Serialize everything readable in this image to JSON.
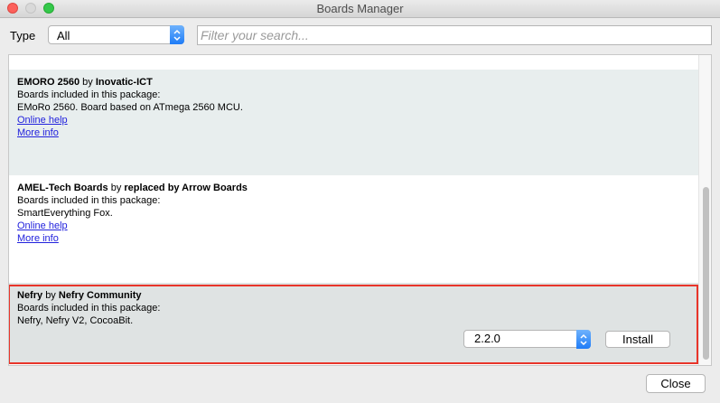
{
  "window": {
    "title": "Boards Manager"
  },
  "toolbar": {
    "type_label": "Type",
    "type_value": "All",
    "search_placeholder": "Filter your search..."
  },
  "boards": [
    {
      "name": "EMORO 2560",
      "by": "by",
      "author": "Inovatic-ICT",
      "included_label": "Boards included in this package:",
      "boards_list": "EMoRo 2560. Board based on ATmega 2560 MCU.",
      "online_help": "Online help",
      "more_info": "More info"
    },
    {
      "name": "AMEL-Tech Boards",
      "by": "by",
      "author": "replaced by Arrow Boards",
      "included_label": "Boards included in this package:",
      "boards_list": "SmartEverything Fox.",
      "online_help": "Online help",
      "more_info": "More info"
    },
    {
      "name": "Nefry",
      "by": "by",
      "author": "Nefry Community",
      "included_label": "Boards included in this package:",
      "boards_list": "Nefry, Nefry V2, CocoaBit.",
      "version": "2.2.0",
      "install_label": "Install"
    }
  ],
  "footer": {
    "close_label": "Close"
  },
  "colors": {
    "selected_row": "#dfe3e3",
    "highlight_border": "#e8352a",
    "link": "#2222dd",
    "accent": "#1e7cf7"
  }
}
